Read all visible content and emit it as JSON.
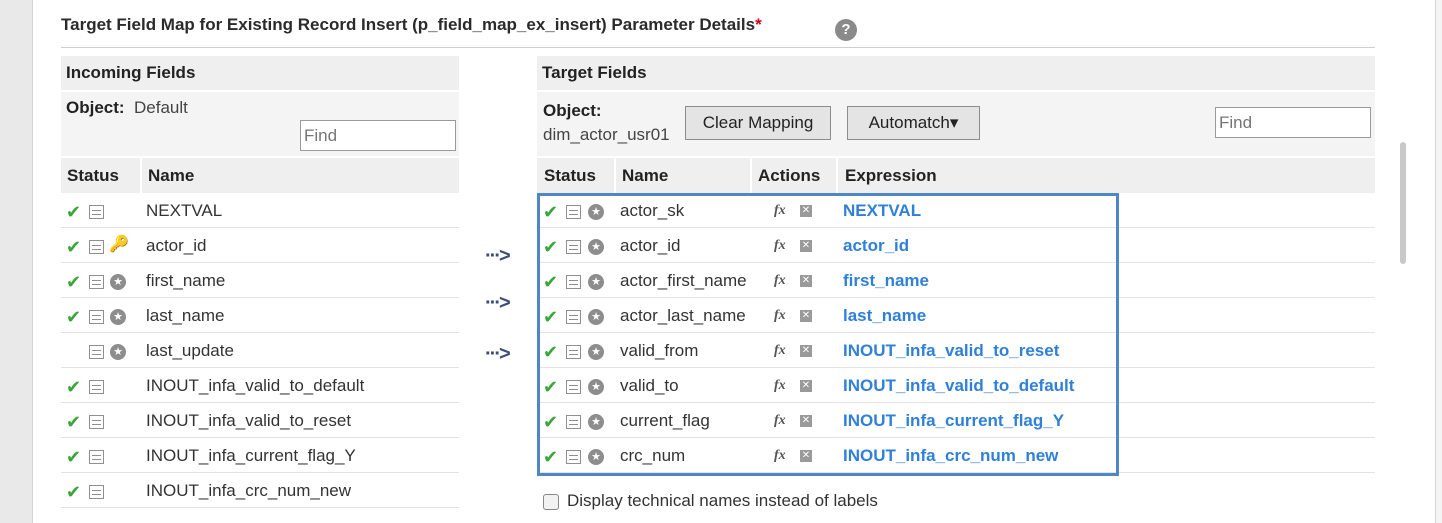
{
  "section": {
    "title": "Target Field Map for Existing Record Insert (p_field_map_ex_insert) Parameter Details",
    "required_mark": "*",
    "help_icon": "?"
  },
  "incoming": {
    "header": "Incoming Fields",
    "object_label": "Object:",
    "object_value": "Default",
    "find_placeholder": "Find",
    "col_status": "Status",
    "col_name": "Name",
    "rows": [
      {
        "name": "NEXTVAL",
        "check": true,
        "badge": "none"
      },
      {
        "name": "actor_id",
        "check": true,
        "badge": "key"
      },
      {
        "name": "first_name",
        "check": true,
        "badge": "star"
      },
      {
        "name": "last_name",
        "check": true,
        "badge": "star"
      },
      {
        "name": "last_update",
        "check": false,
        "badge": "star"
      },
      {
        "name": "INOUT_infa_valid_to_default",
        "check": true,
        "badge": "none"
      },
      {
        "name": "INOUT_infa_valid_to_reset",
        "check": true,
        "badge": "none"
      },
      {
        "name": "INOUT_infa_current_flag_Y",
        "check": true,
        "badge": "none"
      },
      {
        "name": "INOUT_infa_crc_num_new",
        "check": true,
        "badge": "none"
      }
    ]
  },
  "target": {
    "header": "Target Fields",
    "object_label": "Object:",
    "object_value": "dim_actor_usr01",
    "clear_button": "Clear Mapping",
    "automatch_button": "Automatch",
    "automatch_caret": "▾",
    "find_placeholder": "Find",
    "col_status": "Status",
    "col_name": "Name",
    "col_actions": "Actions",
    "col_expression": "Expression",
    "fx_label": "fx",
    "rows": [
      {
        "name": "actor_sk",
        "expression": "NEXTVAL"
      },
      {
        "name": "actor_id",
        "expression": "actor_id"
      },
      {
        "name": "actor_first_name",
        "expression": "first_name"
      },
      {
        "name": "actor_last_name",
        "expression": "last_name"
      },
      {
        "name": "valid_from",
        "expression": "INOUT_infa_valid_to_reset"
      },
      {
        "name": "valid_to",
        "expression": "INOUT_infa_valid_to_default"
      },
      {
        "name": "current_flag",
        "expression": "INOUT_infa_current_flag_Y"
      },
      {
        "name": "crc_num",
        "expression": "INOUT_infa_crc_num_new"
      }
    ]
  },
  "footer": {
    "technical_names_label": "Display technical names instead of labels",
    "technical_names_checked": false
  },
  "glyphs": {
    "check": "✔",
    "key": "🔑",
    "star": "★",
    "x": "✕",
    "arrow": "···>"
  },
  "colors": {
    "expression": "#2f80d8",
    "check": "#3aa63a",
    "highlight": "#4f86c6",
    "required": "#d0021b"
  }
}
